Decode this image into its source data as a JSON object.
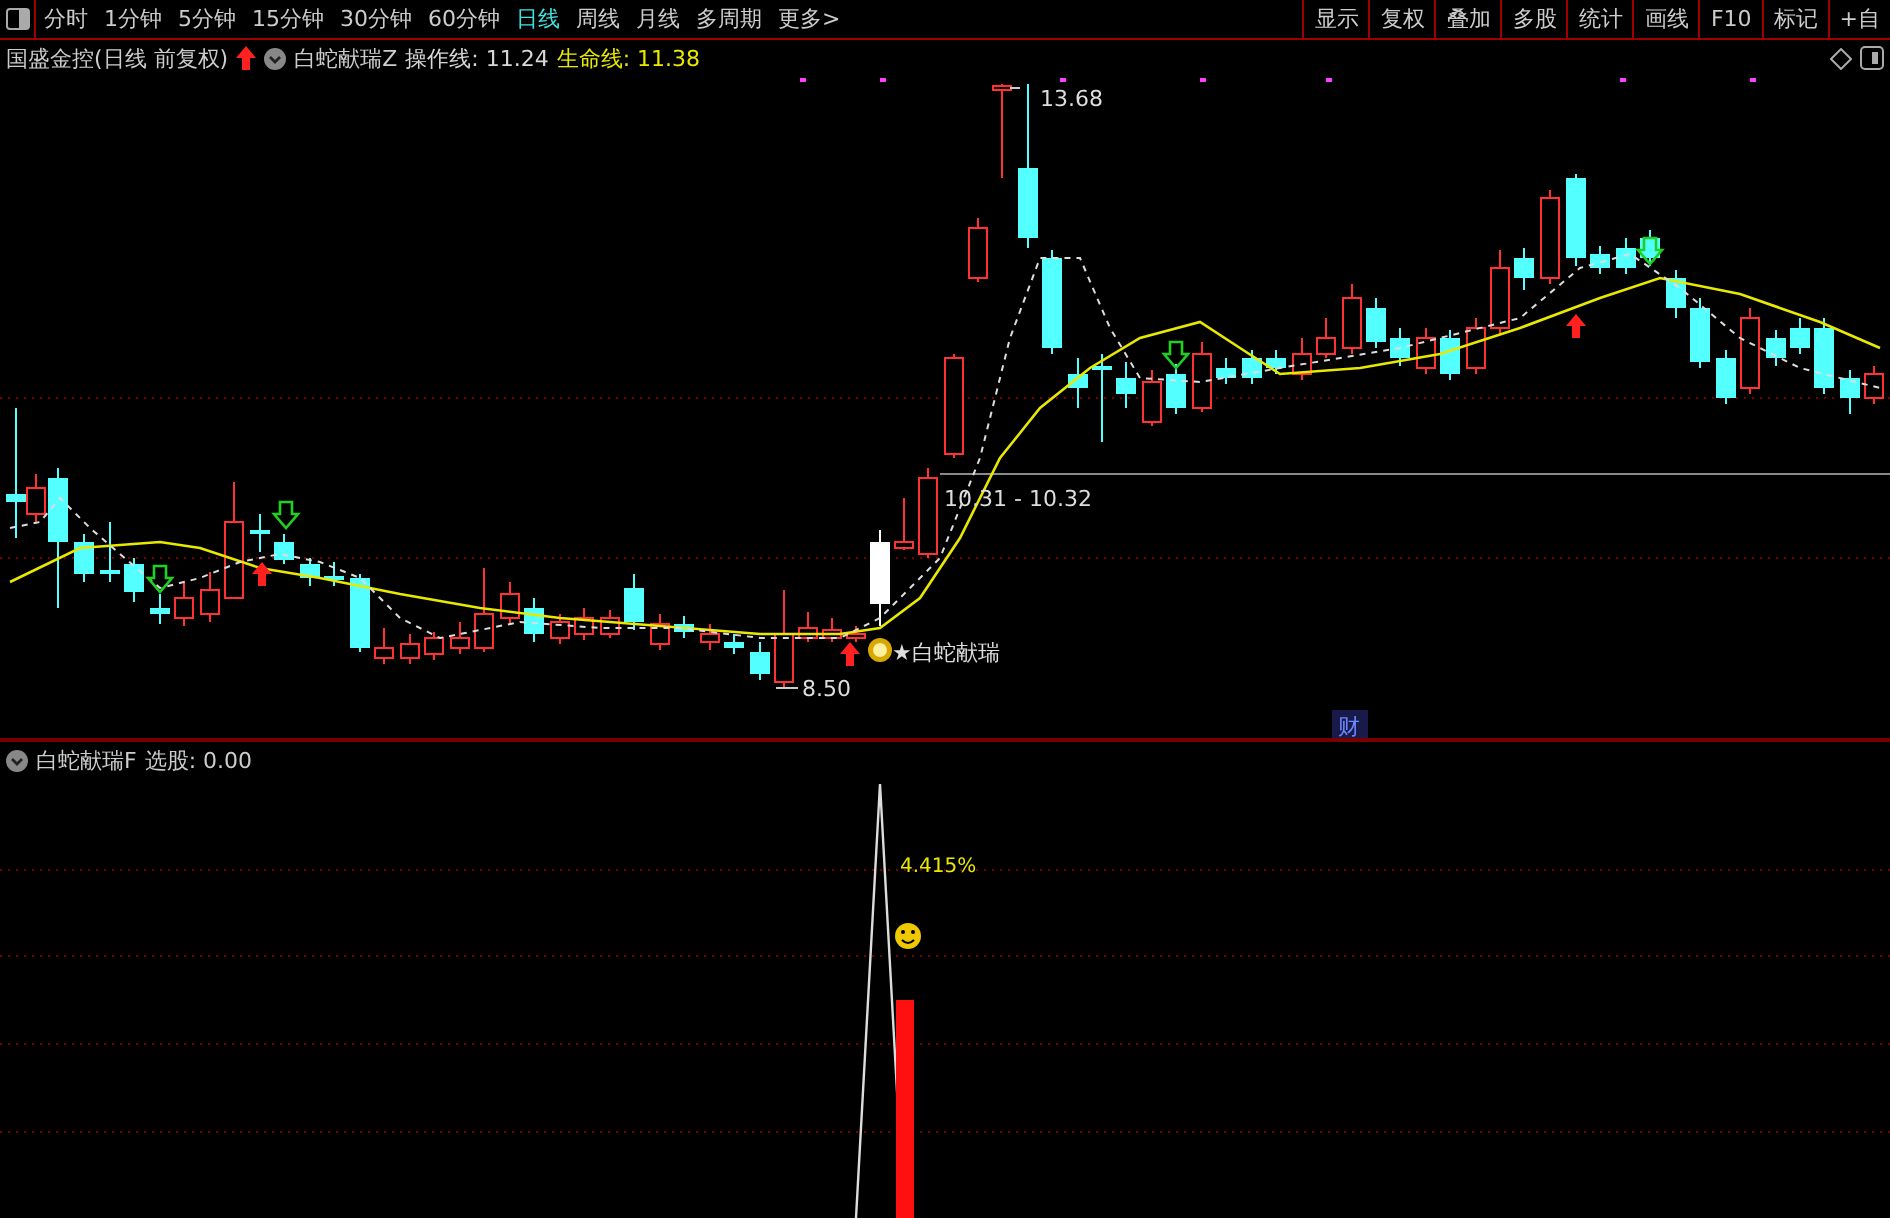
{
  "toolbar": {
    "periods": [
      {
        "label": "分时",
        "selected": false
      },
      {
        "label": "1分钟",
        "selected": false
      },
      {
        "label": "5分钟",
        "selected": false
      },
      {
        "label": "15分钟",
        "selected": false
      },
      {
        "label": "30分钟",
        "selected": false
      },
      {
        "label": "60分钟",
        "selected": false
      },
      {
        "label": "日线",
        "selected": true
      },
      {
        "label": "周线",
        "selected": false
      },
      {
        "label": "月线",
        "selected": false
      },
      {
        "label": "多周期",
        "selected": false
      },
      {
        "label": "更多>",
        "selected": false
      }
    ],
    "buttons": [
      "显示",
      "复权",
      "叠加",
      "多股",
      "统计",
      "画线",
      "F10",
      "标记",
      "+自"
    ]
  },
  "title_bar": {
    "stock": "国盛金控(日线 前复权)",
    "indicator": "白蛇献瑞Z",
    "values": [
      {
        "label": "操作线: 11.24",
        "kind": "operation"
      },
      {
        "label": "生命线: 11.38",
        "kind": "life"
      }
    ]
  },
  "main_chart": {
    "high_label": "13.68",
    "range_label": "10.31 - 10.32",
    "low_label": "8.50",
    "signal_label": "★白蛇献瑞",
    "finance_marker": "财"
  },
  "sub_panel": {
    "title": "白蛇献瑞F",
    "value": "选股: 0.00",
    "peak_label": "4.415%"
  }
}
